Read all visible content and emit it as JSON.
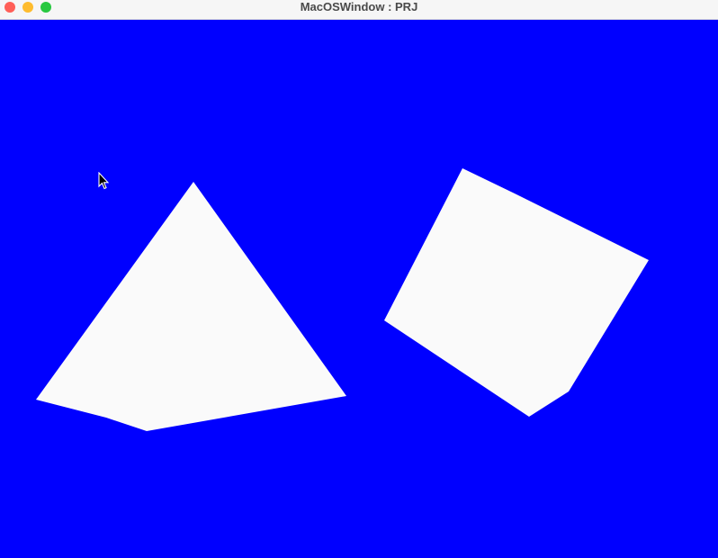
{
  "window": {
    "title": "MacOSWindow : PRJ",
    "traffic_lights": {
      "close_color": "#ff5f57",
      "minimize_color": "#febc2e",
      "zoom_color": "#28c840"
    }
  },
  "viewport": {
    "background_color": "#0000ff",
    "shape_color": "#fafafa",
    "shapes": [
      {
        "kind": "pyramid"
      },
      {
        "kind": "cube"
      }
    ]
  },
  "cursor": {
    "icon": "arrow-cursor-icon"
  }
}
